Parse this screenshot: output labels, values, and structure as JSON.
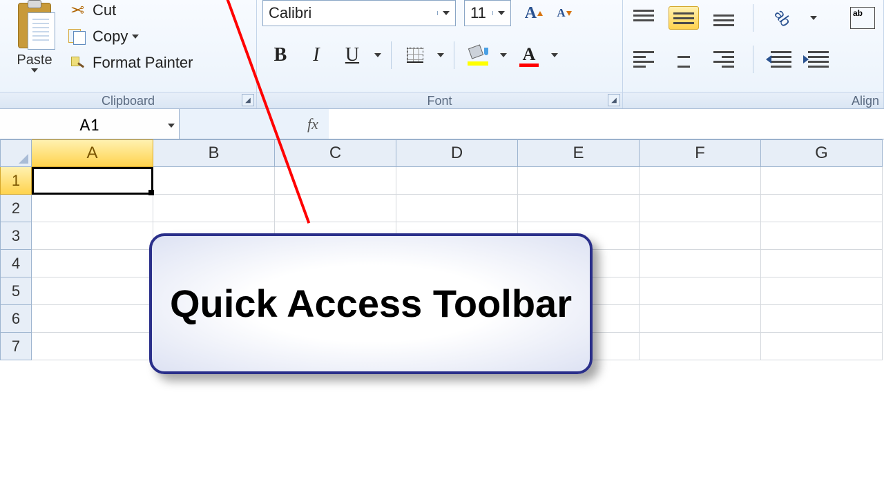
{
  "clipboard": {
    "group_label": "Clipboard",
    "paste_label": "Paste",
    "cut_label": "Cut",
    "copy_label": "Copy",
    "format_painter_label": "Format Painter"
  },
  "font": {
    "group_label": "Font",
    "font_name": "Calibri",
    "font_size": "11",
    "bold_glyph": "B",
    "italic_glyph": "I",
    "underline_glyph": "U",
    "grow_glyph": "A",
    "shrink_glyph": "A",
    "font_color_glyph": "A",
    "fill_color": "#ffff00",
    "font_color": "#ff0000"
  },
  "alignment": {
    "group_label": "Align"
  },
  "formula_bar": {
    "name_box": "A1",
    "fx_label": "fx"
  },
  "sheet": {
    "columns": [
      "A",
      "B",
      "C",
      "D",
      "E",
      "F",
      "G"
    ],
    "rows": [
      "1",
      "2",
      "3",
      "4",
      "5",
      "6",
      "7"
    ],
    "selected_cell": "A1"
  },
  "callout": {
    "text": "Quick Access Toolbar"
  }
}
